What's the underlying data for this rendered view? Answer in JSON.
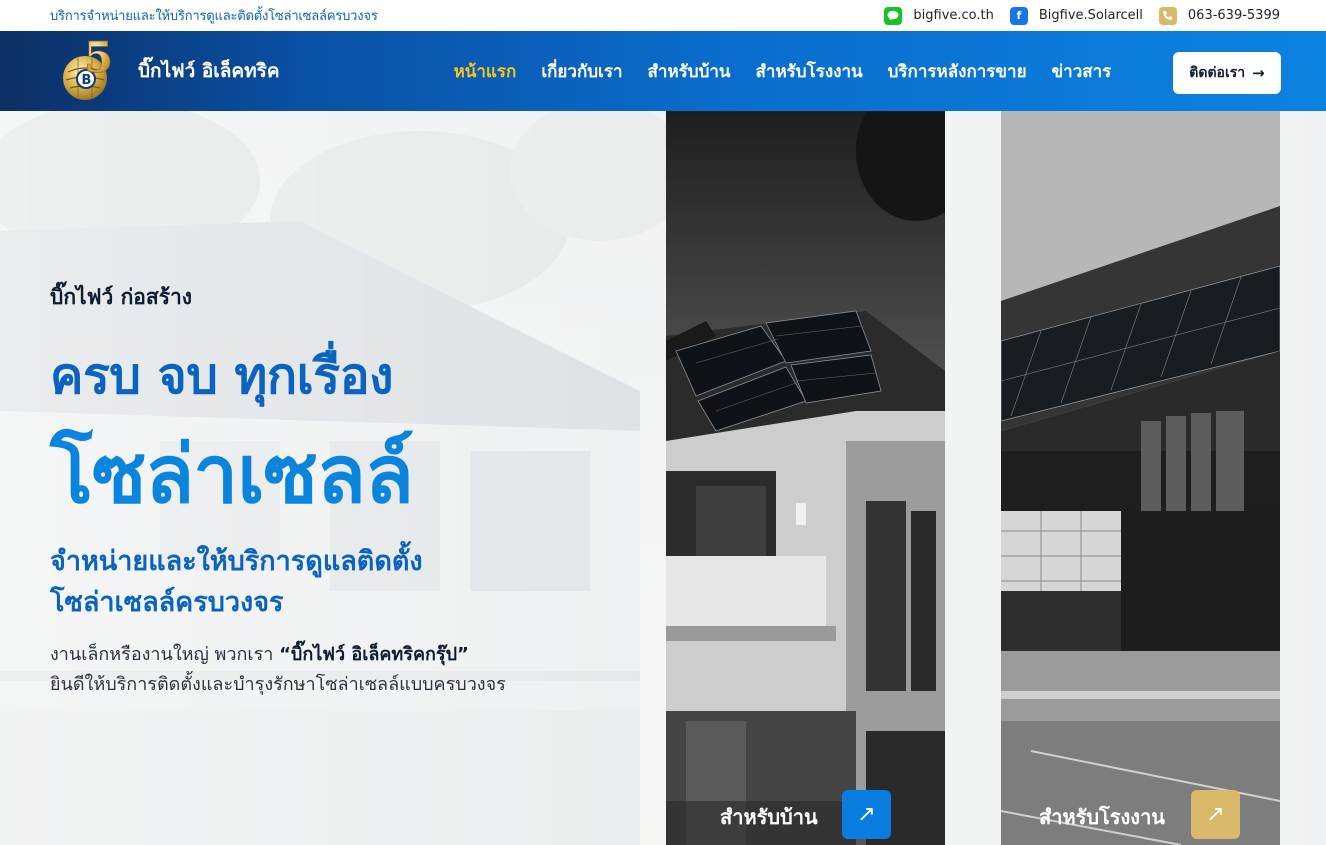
{
  "topbar": {
    "tagline": "บริการจำหน่ายและให้บริการดูและติดตั้งโซล่าเซลล์ครบวงจร",
    "contacts": [
      {
        "icon": "line-icon",
        "label": "bigfive.co.th"
      },
      {
        "icon": "facebook-icon",
        "label": "Bigfive.Solarcell"
      },
      {
        "icon": "phone-icon",
        "label": "063-639-5399"
      }
    ]
  },
  "brand": {
    "name": "บิ๊กไฟว์ อิเล็คทริค",
    "logo_text": "5"
  },
  "nav": {
    "items": [
      {
        "label": "หน้าแรก",
        "active": true
      },
      {
        "label": "เกี่ยวกับเรา"
      },
      {
        "label": "สำหรับบ้าน"
      },
      {
        "label": "สำหรับโรงงาน"
      },
      {
        "label": "บริการหลังการขาย"
      },
      {
        "label": "ข่าวสาร"
      }
    ],
    "contact_button": "ติดต่อเรา",
    "active_color": "#f5c518"
  },
  "hero": {
    "eyebrow": "บิ๊กไฟว์ ก่อสร้าง",
    "headline_1": "ครบ จบ ทุกเรื่อง",
    "headline_2": "โซล่าเซลล์",
    "subheadline_1": "จำหน่ายและให้บริการดูแลติดตั้ง",
    "subheadline_2": "โซล่าเซลล์ครบวงจร",
    "body_1_prefix": "งานเล็กหรืองานใหญ่ พวกเรา ",
    "body_1_brand": "“บิ๊กไฟว์ อิเล็คทริคกรุ๊ป”",
    "body_2": "ยินดีให้บริการติดตั้งและบำรุงรักษาโซล่าเซลล์แบบครบวงจร"
  },
  "cards": [
    {
      "label": "สำหรับบ้าน",
      "accent": "#0a7ee0"
    },
    {
      "label": "สำหรับโรงงาน",
      "accent": "#d9b86a"
    }
  ],
  "colors": {
    "brand_blue": "#0a63c1",
    "nav_gradient_start": "#0c2f63",
    "nav_gradient_end": "#0c82e0",
    "gold": "#d9b86a"
  }
}
